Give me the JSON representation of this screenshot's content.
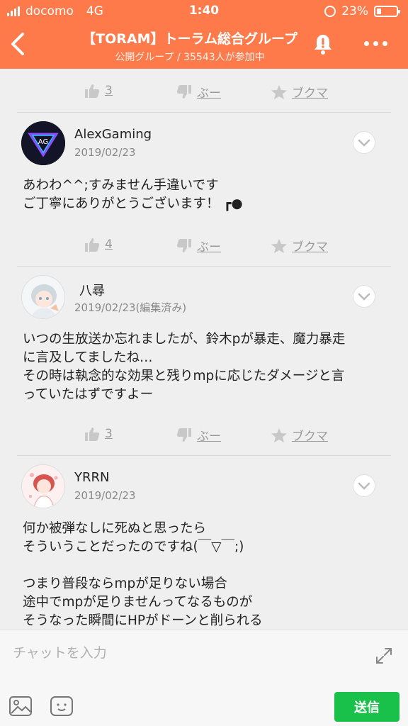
{
  "status_bar": {
    "carrier": "docomo",
    "network": "4G",
    "time": "1:40",
    "battery": "23%"
  },
  "header": {
    "title": "【TORAM】トーラム総合グループ",
    "subtitle": "公開グループ / 35543人が参加中",
    "color": "#ff7a4a"
  },
  "actions_top": {
    "like_count": "3",
    "dislike_label": "ぶー",
    "bookmark_label": "ブクマ"
  },
  "posts": [
    {
      "user": "AlexGaming",
      "avatar_text": "AG",
      "date": "2019/02/23",
      "text": "あわわ^^;すみません手違いです\nご丁寧にありがとうございます！ ┏●",
      "like_count": "4",
      "dislike_label": "ぶー",
      "bookmark_label": "ブクマ"
    },
    {
      "user": "八尋",
      "date": "2019/02/23(編集済み)",
      "text": "いつの生放送か忘れましたが、鈴木pが暴走、魔力暴走\nに言及してましたね…\nその時は執念的な効果と残りmpに応じたダメージと言\nっていたはずですよー",
      "like_count": "3",
      "dislike_label": "ぶー",
      "bookmark_label": "ブクマ"
    },
    {
      "user": "YRRN",
      "date": "2019/02/23",
      "text": "何か被弾なしに死ぬと思ったら\nそういうことだったのですね(￣▽￣;)\n\nつまり普段ならmpが足りない場合\n途中でmpが足りませんってなるものが\nそうなった瞬間にHPがドーンと削られる"
    }
  ],
  "composer": {
    "placeholder": "チャットを入力",
    "send_label": "送信",
    "send_color": "#19c14b"
  }
}
